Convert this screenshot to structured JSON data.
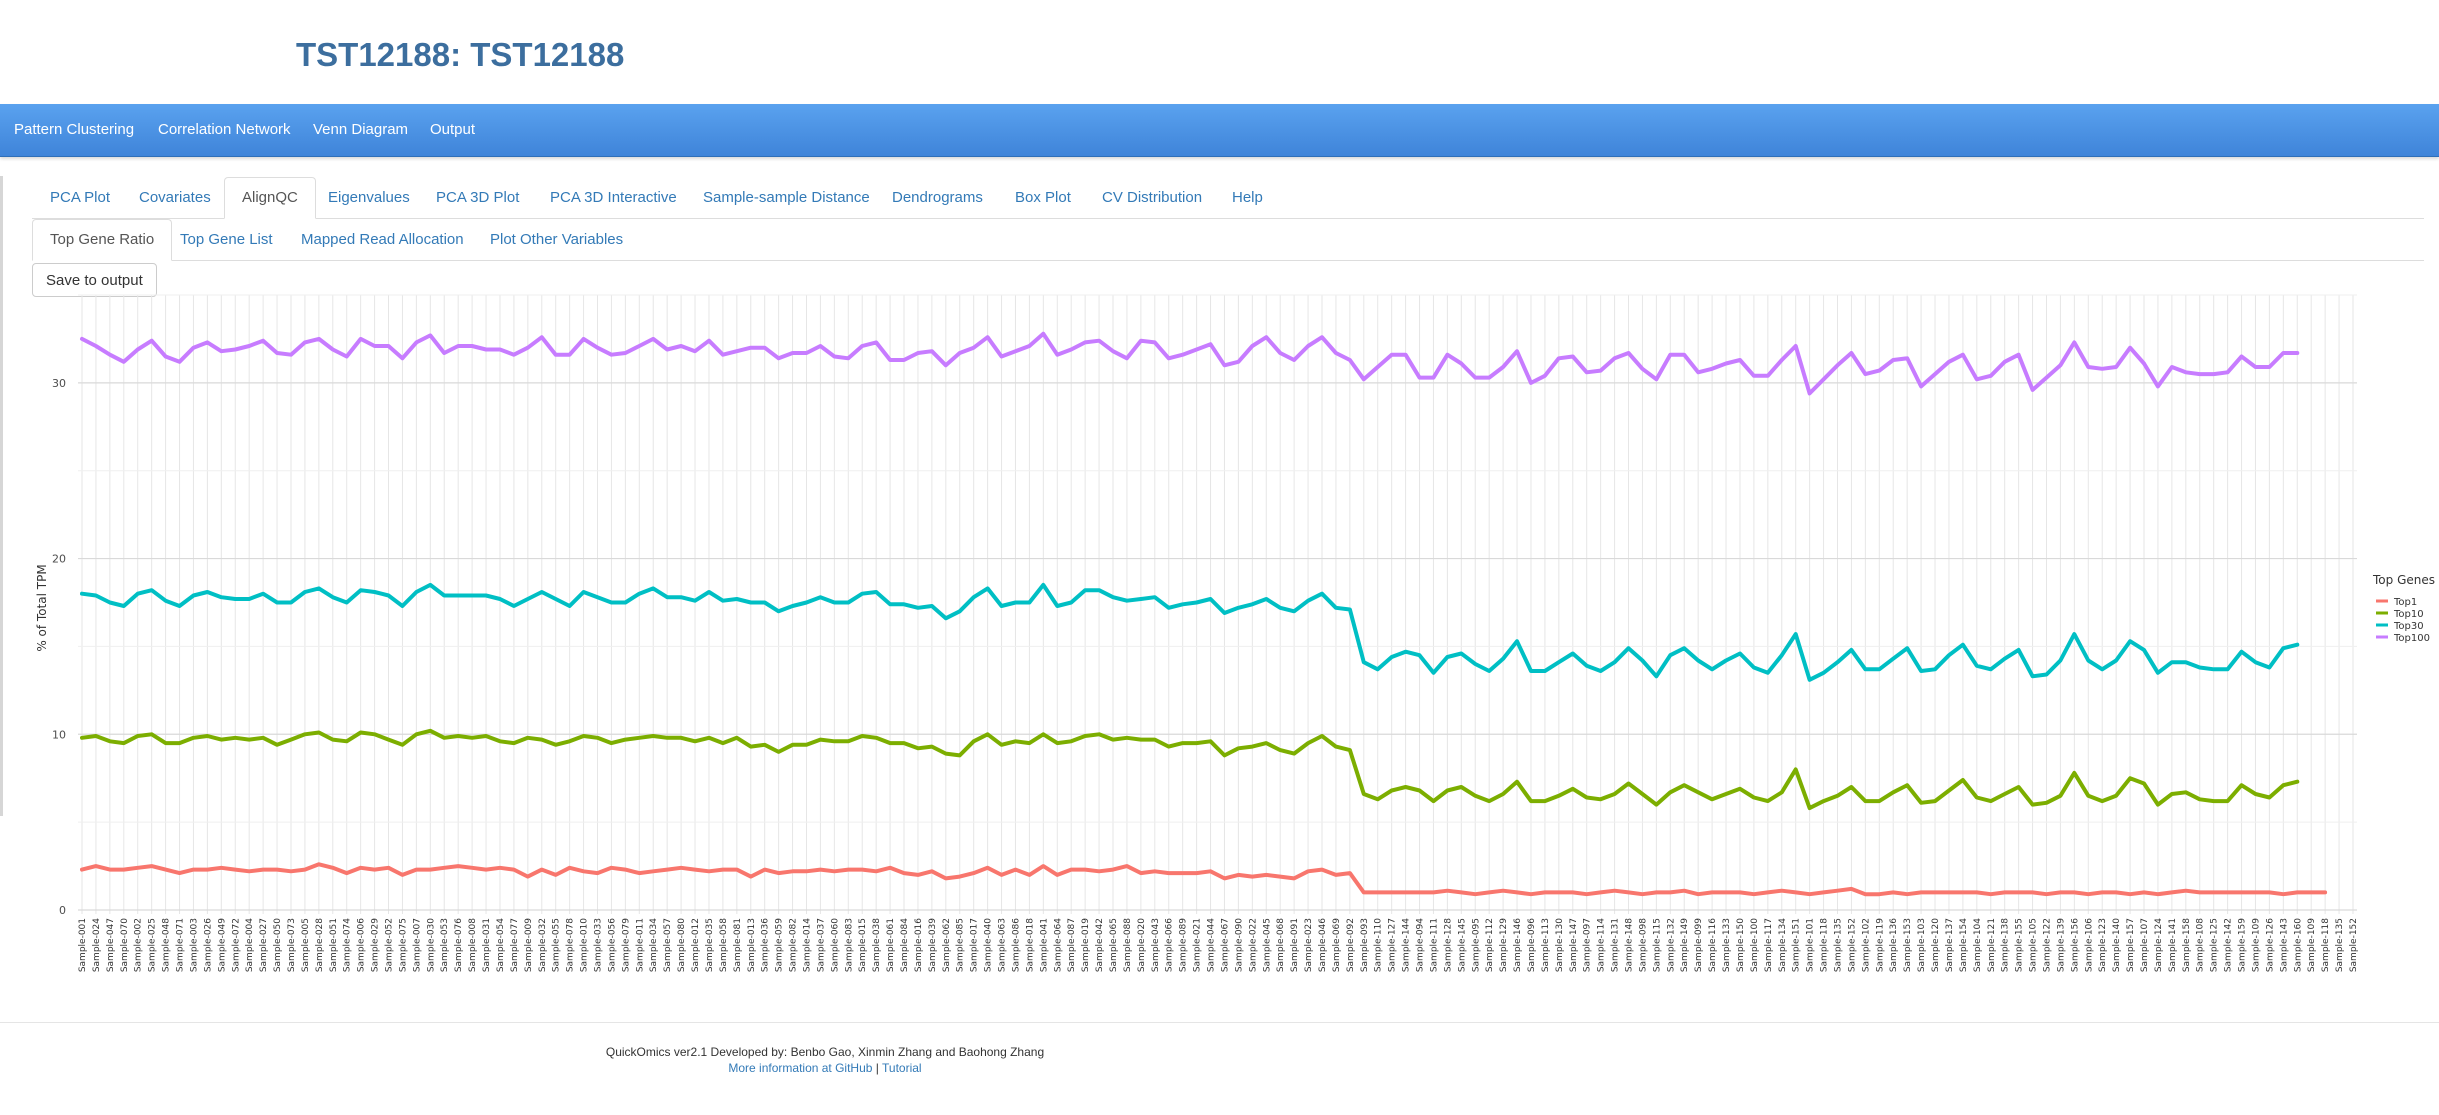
{
  "page_title": "TST12188: TST12188",
  "navbar": {
    "items": [
      {
        "label": "Pattern Clustering"
      },
      {
        "label": "Correlation Network"
      },
      {
        "label": "Venn Diagram"
      },
      {
        "label": "Output"
      }
    ]
  },
  "tabs": [
    {
      "label": "PCA Plot"
    },
    {
      "label": "Covariates"
    },
    {
      "label": "AlignQC",
      "active": true
    },
    {
      "label": "Eigenvalues"
    },
    {
      "label": "PCA 3D Plot"
    },
    {
      "label": "PCA 3D Interactive"
    },
    {
      "label": "Sample-sample Distance"
    },
    {
      "label": "Dendrograms"
    },
    {
      "label": "Box Plot"
    },
    {
      "label": "CV Distribution"
    },
    {
      "label": "Help"
    }
  ],
  "subtabs": [
    {
      "label": "Top Gene Ratio",
      "active": true
    },
    {
      "label": "Top Gene List"
    },
    {
      "label": "Mapped Read Allocation"
    },
    {
      "label": "Plot Other Variables"
    }
  ],
  "save_button": {
    "label": "Save to output"
  },
  "chart_data": {
    "type": "line",
    "title": "",
    "ylabel": "% of Total TPM",
    "xlabel": "",
    "ylim": [
      0,
      35
    ],
    "yticks": [
      0,
      10,
      20,
      30
    ],
    "grid": true,
    "legend_title": "Top Genes",
    "legend_position": "right",
    "categories": [
      "Sample-001",
      "Sample-024",
      "Sample-047",
      "Sample-070",
      "Sample-002",
      "Sample-025",
      "Sample-048",
      "Sample-071",
      "Sample-003",
      "Sample-026",
      "Sample-049",
      "Sample-072",
      "Sample-004",
      "Sample-027",
      "Sample-050",
      "Sample-073",
      "Sample-005",
      "Sample-028",
      "Sample-051",
      "Sample-074",
      "Sample-006",
      "Sample-029",
      "Sample-052",
      "Sample-075",
      "Sample-007",
      "Sample-030",
      "Sample-053",
      "Sample-076",
      "Sample-008",
      "Sample-031",
      "Sample-054",
      "Sample-077",
      "Sample-009",
      "Sample-032",
      "Sample-055",
      "Sample-078",
      "Sample-010",
      "Sample-033",
      "Sample-056",
      "Sample-079",
      "Sample-011",
      "Sample-034",
      "Sample-057",
      "Sample-080",
      "Sample-012",
      "Sample-035",
      "Sample-058",
      "Sample-081",
      "Sample-013",
      "Sample-036",
      "Sample-059",
      "Sample-082",
      "Sample-014",
      "Sample-037",
      "Sample-060",
      "Sample-083",
      "Sample-015",
      "Sample-038",
      "Sample-061",
      "Sample-084",
      "Sample-016",
      "Sample-039",
      "Sample-062",
      "Sample-085",
      "Sample-017",
      "Sample-040",
      "Sample-063",
      "Sample-086",
      "Sample-018",
      "Sample-041",
      "Sample-064",
      "Sample-087",
      "Sample-019",
      "Sample-042",
      "Sample-065",
      "Sample-088",
      "Sample-020",
      "Sample-043",
      "Sample-066",
      "Sample-089",
      "Sample-021",
      "Sample-044",
      "Sample-067",
      "Sample-090",
      "Sample-022",
      "Sample-045",
      "Sample-068",
      "Sample-091",
      "Sample-023",
      "Sample-046",
      "Sample-069",
      "Sample-092",
      "Sample-093",
      "Sample-110",
      "Sample-127",
      "Sample-144",
      "Sample-094",
      "Sample-111",
      "Sample-128",
      "Sample-145",
      "Sample-095",
      "Sample-112",
      "Sample-129",
      "Sample-146",
      "Sample-096",
      "Sample-113",
      "Sample-130",
      "Sample-147",
      "Sample-097",
      "Sample-114",
      "Sample-131",
      "Sample-148",
      "Sample-098",
      "Sample-115",
      "Sample-132",
      "Sample-149",
      "Sample-099",
      "Sample-116",
      "Sample-133",
      "Sample-150",
      "Sample-100",
      "Sample-117",
      "Sample-134",
      "Sample-151",
      "Sample-101",
      "Sample-118",
      "Sample-135",
      "Sample-152",
      "Sample-102",
      "Sample-119",
      "Sample-136",
      "Sample-153",
      "Sample-103",
      "Sample-120",
      "Sample-137",
      "Sample-154",
      "Sample-104",
      "Sample-121",
      "Sample-138",
      "Sample-155",
      "Sample-105",
      "Sample-122",
      "Sample-139",
      "Sample-156",
      "Sample-106",
      "Sample-123",
      "Sample-140",
      "Sample-157",
      "Sample-107",
      "Sample-124",
      "Sample-141",
      "Sample-158",
      "Sample-108",
      "Sample-125",
      "Sample-142",
      "Sample-159",
      "Sample-109",
      "Sample-126",
      "Sample-143",
      "Sample-160",
      "Sample-109",
      "Sample-118",
      "Sample-135",
      "Sample-152"
    ],
    "series": [
      {
        "name": "Top1",
        "color": "#f8766d",
        "values": [
          2.3,
          2.5,
          2.3,
          2.3,
          2.4,
          2.5,
          2.3,
          2.1,
          2.3,
          2.3,
          2.4,
          2.3,
          2.2,
          2.3,
          2.3,
          2.2,
          2.3,
          2.6,
          2.4,
          2.1,
          2.4,
          2.3,
          2.4,
          2.0,
          2.3,
          2.3,
          2.4,
          2.5,
          2.4,
          2.3,
          2.4,
          2.3,
          1.9,
          2.3,
          2.0,
          2.4,
          2.2,
          2.1,
          2.4,
          2.3,
          2.1,
          2.2,
          2.3,
          2.4,
          2.3,
          2.2,
          2.3,
          2.3,
          1.9,
          2.3,
          2.1,
          2.2,
          2.2,
          2.3,
          2.2,
          2.3,
          2.3,
          2.2,
          2.4,
          2.1,
          2.0,
          2.2,
          1.8,
          1.9,
          2.1,
          2.4,
          2.0,
          2.3,
          2.0,
          2.5,
          2.0,
          2.3,
          2.3,
          2.2,
          2.3,
          2.5,
          2.1,
          2.2,
          2.1,
          2.1,
          2.1,
          2.2,
          1.8,
          2.0,
          1.9,
          2.0,
          1.9,
          1.8,
          2.2,
          2.3,
          2.0,
          2.1,
          1.0,
          1.0,
          1.0,
          1.0,
          1.0,
          1.0,
          1.1,
          1.0,
          0.9,
          1.0,
          1.1,
          1.0,
          0.9,
          1.0,
          1.0,
          1.0,
          0.9,
          1.0,
          1.1,
          1.0,
          0.9,
          1.0,
          1.0,
          1.1,
          0.9,
          1.0,
          1.0,
          1.0,
          0.9,
          1.0,
          1.1,
          1.0,
          0.9,
          1.0,
          1.1,
          1.2,
          0.9,
          0.9,
          1.0,
          0.9,
          1.0,
          1.0,
          1.0,
          1.0,
          1.0,
          0.9,
          1.0,
          1.0,
          1.0,
          0.9,
          1.0,
          1.0,
          0.9,
          1.0,
          1.0,
          0.9,
          1.0,
          0.9,
          1.0,
          1.1,
          1.0,
          1.0,
          1.0,
          1.0,
          1.0,
          1.0,
          0.9,
          1.0,
          1.0,
          1.0
        ]
      },
      {
        "name": "Top10",
        "color": "#7cae00",
        "values": [
          9.8,
          9.9,
          9.6,
          9.5,
          9.9,
          10.0,
          9.5,
          9.5,
          9.8,
          9.9,
          9.7,
          9.8,
          9.7,
          9.8,
          9.4,
          9.7,
          10.0,
          10.1,
          9.7,
          9.6,
          10.1,
          10.0,
          9.7,
          9.4,
          10.0,
          10.2,
          9.8,
          9.9,
          9.8,
          9.9,
          9.6,
          9.5,
          9.8,
          9.7,
          9.4,
          9.6,
          9.9,
          9.8,
          9.5,
          9.7,
          9.8,
          9.9,
          9.8,
          9.8,
          9.6,
          9.8,
          9.5,
          9.8,
          9.3,
          9.4,
          9.0,
          9.4,
          9.4,
          9.7,
          9.6,
          9.6,
          9.9,
          9.8,
          9.5,
          9.5,
          9.2,
          9.3,
          8.9,
          8.8,
          9.6,
          10.0,
          9.4,
          9.6,
          9.5,
          10.0,
          9.5,
          9.6,
          9.9,
          10.0,
          9.7,
          9.8,
          9.7,
          9.7,
          9.3,
          9.5,
          9.5,
          9.6,
          8.8,
          9.2,
          9.3,
          9.5,
          9.1,
          8.9,
          9.5,
          9.9,
          9.3,
          9.1,
          6.6,
          6.3,
          6.8,
          7.0,
          6.8,
          6.2,
          6.8,
          7.0,
          6.5,
          6.2,
          6.6,
          7.3,
          6.2,
          6.2,
          6.5,
          6.9,
          6.4,
          6.3,
          6.6,
          7.2,
          6.6,
          6.0,
          6.7,
          7.1,
          6.7,
          6.3,
          6.6,
          6.9,
          6.4,
          6.2,
          6.7,
          8.0,
          5.8,
          6.2,
          6.5,
          7.0,
          6.2,
          6.2,
          6.7,
          7.1,
          6.1,
          6.2,
          6.8,
          7.4,
          6.4,
          6.2,
          6.6,
          7.0,
          6.0,
          6.1,
          6.5,
          7.8,
          6.5,
          6.2,
          6.5,
          7.5,
          7.2,
          6.0,
          6.6,
          6.7,
          6.3,
          6.2,
          6.2,
          7.1,
          6.6,
          6.4,
          7.1,
          7.3
        ]
      },
      {
        "name": "Top30",
        "color": "#00bfc4",
        "values": [
          18.0,
          17.9,
          17.5,
          17.3,
          18.0,
          18.2,
          17.6,
          17.3,
          17.9,
          18.1,
          17.8,
          17.7,
          17.7,
          18.0,
          17.5,
          17.5,
          18.1,
          18.3,
          17.8,
          17.5,
          18.2,
          18.1,
          17.9,
          17.3,
          18.1,
          18.5,
          17.9,
          17.9,
          17.9,
          17.9,
          17.7,
          17.3,
          17.7,
          18.1,
          17.7,
          17.3,
          18.1,
          17.8,
          17.5,
          17.5,
          18.0,
          18.3,
          17.8,
          17.8,
          17.6,
          18.1,
          17.6,
          17.7,
          17.5,
          17.5,
          17.0,
          17.3,
          17.5,
          17.8,
          17.5,
          17.5,
          18.0,
          18.1,
          17.4,
          17.4,
          17.2,
          17.3,
          16.6,
          17.0,
          17.8,
          18.3,
          17.3,
          17.5,
          17.5,
          18.5,
          17.3,
          17.5,
          18.2,
          18.2,
          17.8,
          17.6,
          17.7,
          17.8,
          17.2,
          17.4,
          17.5,
          17.7,
          16.9,
          17.2,
          17.4,
          17.7,
          17.2,
          17.0,
          17.6,
          18.0,
          17.2,
          17.1,
          14.1,
          13.7,
          14.4,
          14.7,
          14.5,
          13.5,
          14.4,
          14.6,
          14.0,
          13.6,
          14.3,
          15.3,
          13.6,
          13.6,
          14.1,
          14.6,
          13.9,
          13.6,
          14.1,
          14.9,
          14.2,
          13.3,
          14.5,
          14.9,
          14.2,
          13.7,
          14.2,
          14.6,
          13.8,
          13.5,
          14.5,
          15.7,
          13.1,
          13.5,
          14.1,
          14.8,
          13.7,
          13.7,
          14.3,
          14.9,
          13.6,
          13.7,
          14.5,
          15.1,
          13.9,
          13.7,
          14.3,
          14.8,
          13.3,
          13.4,
          14.2,
          15.7,
          14.2,
          13.7,
          14.2,
          15.3,
          14.8,
          13.5,
          14.1,
          14.1,
          13.8,
          13.7,
          13.7,
          14.7,
          14.1,
          13.8,
          14.9,
          15.1
        ]
      },
      {
        "name": "Top100",
        "color": "#c77cff",
        "values": [
          32.5,
          32.1,
          31.6,
          31.2,
          31.9,
          32.4,
          31.5,
          31.2,
          32.0,
          32.3,
          31.8,
          31.9,
          32.1,
          32.4,
          31.7,
          31.6,
          32.3,
          32.5,
          31.9,
          31.5,
          32.5,
          32.1,
          32.1,
          31.4,
          32.3,
          32.7,
          31.7,
          32.1,
          32.1,
          31.9,
          31.9,
          31.6,
          32.0,
          32.6,
          31.6,
          31.6,
          32.5,
          32.0,
          31.6,
          31.7,
          32.1,
          32.5,
          31.9,
          32.1,
          31.8,
          32.4,
          31.6,
          31.8,
          32.0,
          32.0,
          31.4,
          31.7,
          31.7,
          32.1,
          31.5,
          31.4,
          32.1,
          32.3,
          31.3,
          31.3,
          31.7,
          31.8,
          31.0,
          31.7,
          32.0,
          32.6,
          31.5,
          31.8,
          32.1,
          32.8,
          31.6,
          31.9,
          32.3,
          32.4,
          31.8,
          31.4,
          32.4,
          32.3,
          31.4,
          31.6,
          31.9,
          32.2,
          31.0,
          31.2,
          32.1,
          32.6,
          31.7,
          31.3,
          32.1,
          32.6,
          31.7,
          31.3,
          30.2,
          30.9,
          31.6,
          31.6,
          30.3,
          30.3,
          31.6,
          31.1,
          30.3,
          30.3,
          30.9,
          31.8,
          30.0,
          30.4,
          31.4,
          31.5,
          30.6,
          30.7,
          31.4,
          31.7,
          30.8,
          30.2,
          31.6,
          31.6,
          30.6,
          30.8,
          31.1,
          31.3,
          30.4,
          30.4,
          31.3,
          32.1,
          29.4,
          30.2,
          31.0,
          31.7,
          30.5,
          30.7,
          31.3,
          31.4,
          29.8,
          30.5,
          31.2,
          31.6,
          30.2,
          30.4,
          31.2,
          31.6,
          29.6,
          30.3,
          31.0,
          32.3,
          30.9,
          30.8,
          30.9,
          32.0,
          31.1,
          29.8,
          30.9,
          30.6,
          30.5,
          30.5,
          30.6,
          31.5,
          30.9,
          30.9,
          31.7,
          31.7
        ]
      }
    ]
  },
  "footer": {
    "line1": "QuickOmics ver2.1 Developed by: Benbo Gao, Xinmin Zhang and Baohong Zhang",
    "github_label": "More information at GitHub",
    "separator": "|",
    "tutorial_label": "Tutorial"
  }
}
